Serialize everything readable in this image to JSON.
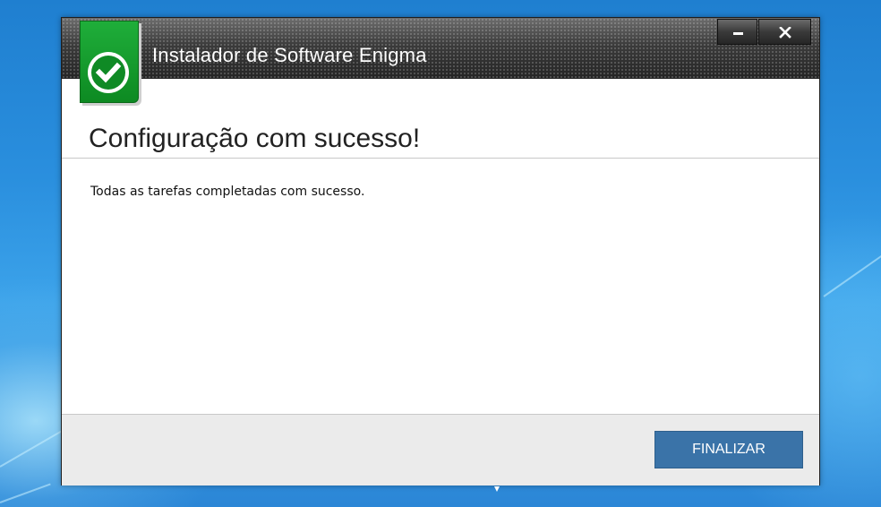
{
  "window": {
    "title": "Instalador de Software Enigma",
    "minimize_label": "",
    "close_label": ""
  },
  "icons": {
    "app_logo": "check-circle-icon",
    "minimize": "minimize-icon",
    "close": "close-icon"
  },
  "content": {
    "heading": "Configuração com sucesso!",
    "message": "Todas as tarefas completadas com sucesso."
  },
  "footer": {
    "finish_label": "FINALIZAR"
  },
  "colors": {
    "brand_green": "#1fae3a",
    "button_blue": "#3a73a8",
    "titlebar_dark": "#2f2f2f",
    "desktop_blue": "#2a8fde"
  }
}
